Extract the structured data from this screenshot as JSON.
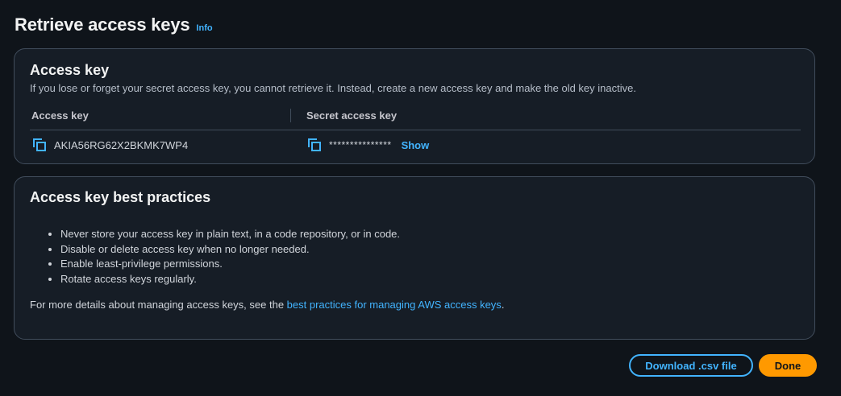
{
  "header": {
    "title": "Retrieve access keys",
    "info_label": "Info"
  },
  "access_key_panel": {
    "title": "Access key",
    "description": "If you lose or forget your secret access key, you cannot retrieve it. Instead, create a new access key and make the old key inactive.",
    "columns": [
      "Access key",
      "Secret access key"
    ],
    "access_key_value": "AKIA56RG62X2BKMK7WP4",
    "secret_key_masked": "***************",
    "show_label": "Show",
    "icons": {
      "copy": "copy-icon"
    }
  },
  "best_practices_panel": {
    "title": "Access key best practices",
    "items": [
      "Never store your access key in plain text, in a code repository, or in code.",
      "Disable or delete access key when no longer needed.",
      "Enable least-privilege permissions.",
      "Rotate access keys regularly."
    ],
    "more_prefix": "For more details about managing access keys, see the ",
    "more_link": "best practices for managing AWS access keys",
    "more_suffix": "."
  },
  "footer": {
    "download_label": "Download .csv file",
    "done_label": "Done"
  },
  "colors": {
    "background": "#0f141a",
    "panel": "#161d26",
    "accent_link": "#42b4ff",
    "primary_button": "#ff9900"
  }
}
